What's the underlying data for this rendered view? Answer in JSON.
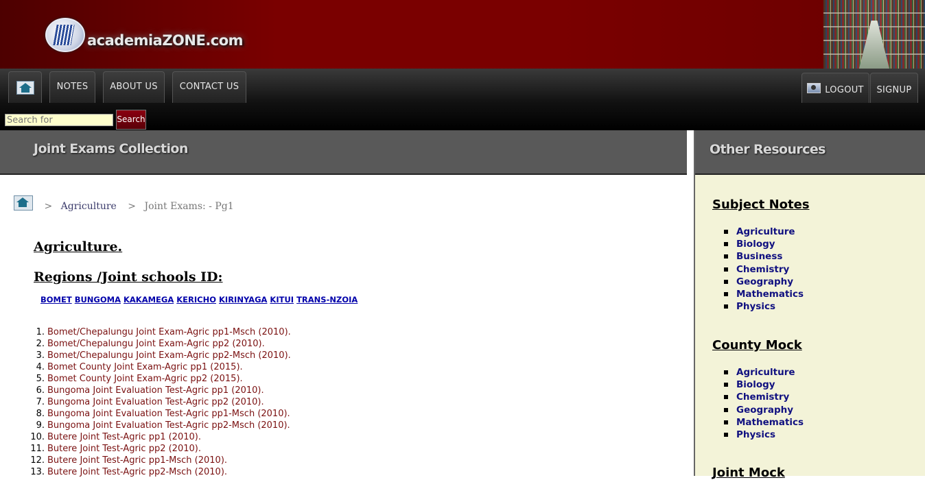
{
  "header": {
    "logo_text": "academiaZONE.com"
  },
  "nav": {
    "notes": "NOTES",
    "about": "ABOUT US",
    "contact": "CONTACT US",
    "logout": "LOGOUT",
    "signup": "SIGNUP"
  },
  "search": {
    "placeholder": "Search for",
    "button": "Search"
  },
  "main": {
    "title": "Joint Exams Collection",
    "breadcrumb": {
      "sep1": ">",
      "subject": "Agriculture",
      "sep2": ">",
      "current": "Joint Exams:  - Pg1"
    },
    "heading": "Agriculture.",
    "regions_heading": "Regions /Joint schools ID:",
    "regions": [
      "BOMET",
      "BUNGOMA",
      "KAKAMEGA",
      "KERICHO",
      "KIRINYAGA",
      "KITUI",
      "TRANS-NZOIA"
    ],
    "papers": [
      "Bomet/Chepalungu Joint Exam-Agric pp1-Msch (2010).",
      "Bomet/Chepalungu Joint Exam-Agric pp2 (2010).",
      "Bomet/Chepalungu Joint Exam-Agric pp2-Msch (2010).",
      "Bomet County Joint Exam-Agric pp1 (2015).",
      "Bomet County Joint Exam-Agric pp2 (2015).",
      "Bungoma Joint Evaluation Test-Agric pp1 (2010).",
      "Bungoma Joint Evaluation Test-Agric pp2 (2010).",
      "Bungoma Joint Evaluation Test-Agric pp1-Msch (2010).",
      "Bungoma Joint Evaluation Test-Agric pp2-Msch (2010).",
      "Butere Joint Test-Agric pp1 (2010).",
      "Butere Joint Test-Agric pp2 (2010).",
      "Butere Joint Test-Agric pp1-Msch (2010).",
      "Butere Joint Test-Agric pp2-Msch (2010)."
    ]
  },
  "sidebar": {
    "title": "Other Resources",
    "subject_notes": {
      "heading": "Subject Notes",
      "items": [
        "Agriculture",
        "Biology",
        "Business",
        "Chemistry",
        "Geography",
        "Mathematics",
        "Physics"
      ]
    },
    "county_mock": {
      "heading": "County Mock",
      "items": [
        "Agriculture",
        "Biology",
        "Chemistry",
        "Geography",
        "Mathematics",
        "Physics"
      ]
    },
    "joint_mock": {
      "heading": "Joint Mock"
    }
  }
}
